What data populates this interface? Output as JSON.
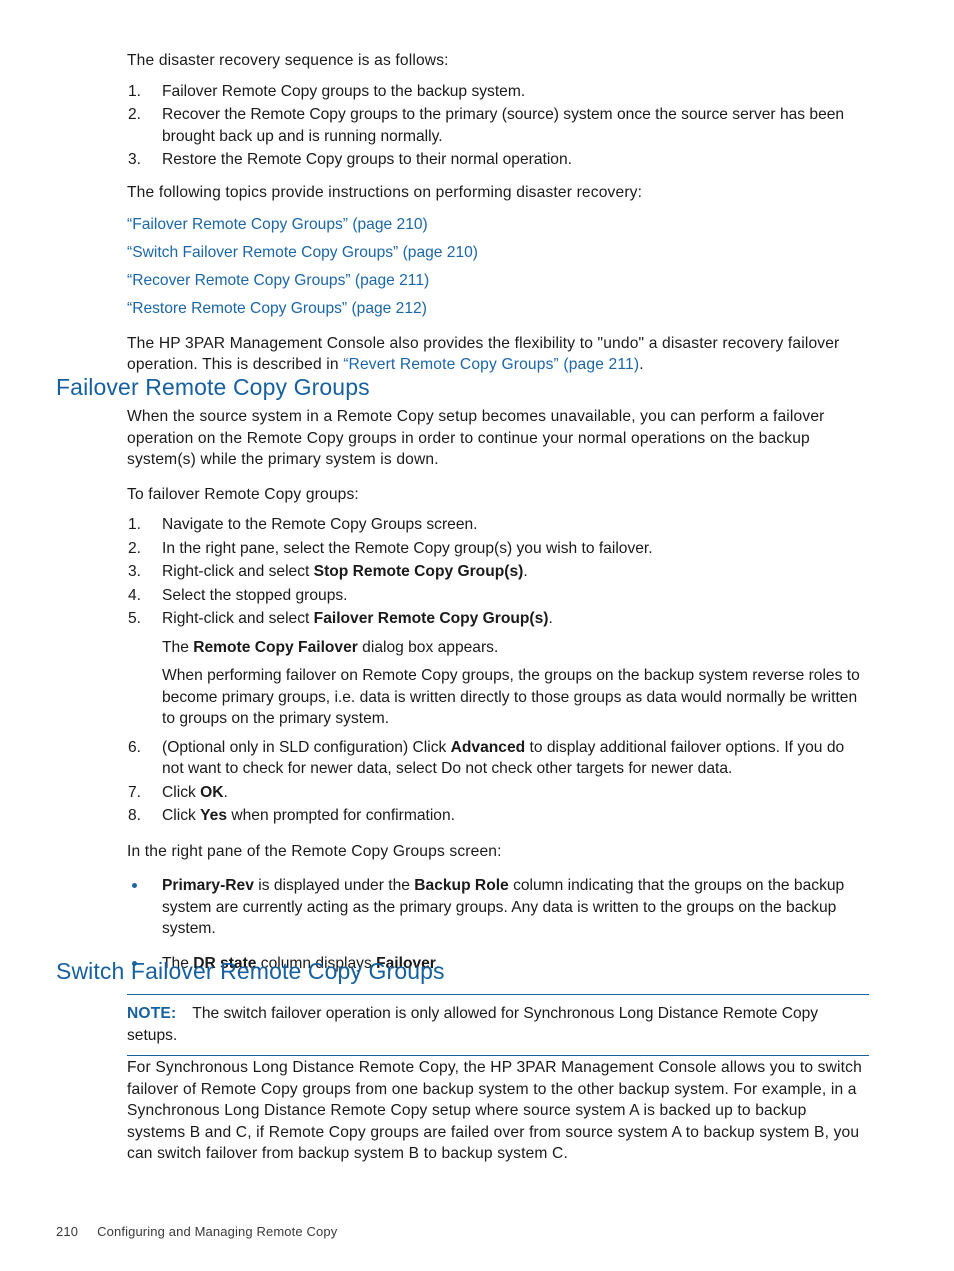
{
  "document": {
    "intro": {
      "lead": "The disaster recovery sequence is as follows:",
      "steps": [
        {
          "num": "1.",
          "text": "Failover Remote Copy groups to the backup system."
        },
        {
          "num": "2.",
          "text": "Recover the Remote Copy groups to the primary (source) system once the source server has been brought back up and is running normally."
        },
        {
          "num": "3.",
          "text": "Restore the Remote Copy groups to their normal operation."
        }
      ],
      "topics_lead": "The following topics provide instructions on performing disaster recovery:",
      "links": [
        "“Failover Remote Copy Groups” (page 210)",
        "“Switch Failover Remote Copy Groups” (page 210)",
        "“Recover Remote Copy Groups” (page 211)",
        "“Restore Remote Copy Groups” (page 212)"
      ],
      "undo_para_part1": "The HP 3PAR Management Console also provides the flexibility to \"undo\" a disaster recovery failover operation. This is described in ",
      "undo_para_link": "“Revert Remote Copy Groups” (page 211)",
      "undo_para_part2": "."
    },
    "section_failover": {
      "heading": "Failover Remote Copy Groups",
      "intro_para": "When the source system in a Remote Copy setup becomes unavailable, you can perform a failover operation on the Remote Copy groups in order to continue your normal operations on the backup system(s) while the primary system is down.",
      "steps_lead": "To failover Remote Copy groups:",
      "step1_num": "1.",
      "step1_text": "Navigate to the Remote Copy Groups screen.",
      "step2_num": "2.",
      "step2_text": "In the right pane, select the Remote Copy group(s) you wish to failover.",
      "step3_num": "3.",
      "step3_pre": "Right-click and select ",
      "step3_bold": "Stop Remote Copy Group(s)",
      "step3_post": ".",
      "step4_num": "4.",
      "step4_text": "Select the stopped groups.",
      "step5_num": "5.",
      "step5_pre": "Right-click and select ",
      "step5_bold": "Failover Remote Copy Group(s)",
      "step5_post": ".",
      "step5_sub1_pre": "The ",
      "step5_sub1_bold": "Remote Copy Failover",
      "step5_sub1_post": " dialog box appears.",
      "step5_sub2": "When performing failover on Remote Copy groups, the groups on the backup system reverse roles to become primary groups, i.e. data is written directly to those groups as data would normally be written to groups on the primary system.",
      "step6_num": "6.",
      "step6_pre": "(Optional only in SLD configuration) Click ",
      "step6_bold": "Advanced",
      "step6_post": " to display additional failover options. If you do not want to check for newer data, select Do not check other targets for newer data.",
      "step7_num": "7.",
      "step7_pre": "Click ",
      "step7_bold": "OK",
      "step7_post": ".",
      "step8_num": "8.",
      "step8_pre": "Click ",
      "step8_bold": "Yes",
      "step8_post": " when prompted for confirmation.",
      "result_lead": "In the right pane of the Remote Copy Groups screen:",
      "bullet1_bold1": "Primary-Rev",
      "bullet1_mid1": " is displayed under the ",
      "bullet1_bold2": "Backup Role",
      "bullet1_post": " column indicating that the groups on the backup system are currently acting as the primary groups. Any data is written to the groups on the backup system.",
      "bullet2_pre": "The ",
      "bullet2_bold1": "DR state",
      "bullet2_mid": " column displays ",
      "bullet2_bold2": "Failover",
      "bullet2_post": "."
    },
    "section_switch": {
      "heading": "Switch Failover Remote Copy Groups",
      "note_label": "NOTE:",
      "note_text": "The switch failover operation is only allowed for Synchronous Long Distance Remote Copy setups.",
      "body_para": "For Synchronous Long Distance Remote Copy, the HP 3PAR Management Console allows you to switch failover of Remote Copy groups from one backup system to the other backup system. For example, in a Synchronous Long Distance Remote Copy setup where source system A is backed up to backup systems B and C, if Remote Copy groups are failed over from source system A to backup system B, you can switch failover from backup system B to backup system C."
    },
    "footer": {
      "page_number": "210",
      "chapter_title": "Configuring and Managing Remote Copy"
    },
    "colors": {
      "heading_blue": "#17609f",
      "link_blue": "#1b66a8",
      "body_black": "#1a1a1a",
      "background": "#ffffff"
    }
  }
}
